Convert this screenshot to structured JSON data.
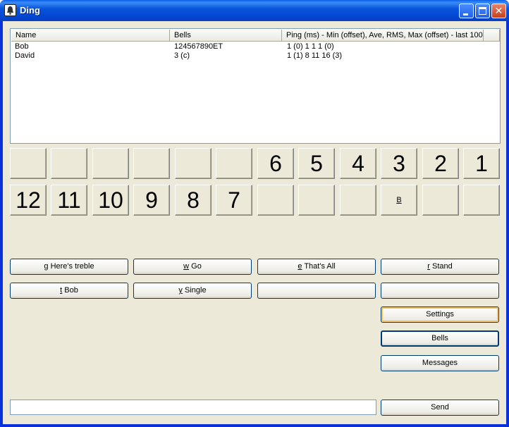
{
  "window": {
    "title": "Ding"
  },
  "players_list": {
    "columns": [
      "Name",
      "Bells",
      "Ping (ms) - Min (offset), Ave, RMS, Max (offset) - last 100"
    ],
    "rows": [
      {
        "name": "Bob",
        "bells": "124567890ET",
        "ping": "1 (0) 1 1 1 (0)"
      },
      {
        "name": "David",
        "bells": "3 (c)",
        "ping": "1 (1) 8 11 16 (3)"
      }
    ]
  },
  "bells": {
    "row1": [
      "",
      "",
      "",
      "",
      "",
      "",
      "6",
      "5",
      "4",
      "3",
      "2",
      "1"
    ],
    "row2": [
      "12",
      "11",
      "10",
      "9",
      "8",
      "7",
      "",
      "",
      "",
      "B",
      "",
      ""
    ]
  },
  "commands": {
    "heres_treble": {
      "key": "g",
      "label": " Here's treble"
    },
    "go": {
      "key": "w",
      "label": " Go"
    },
    "thats_all": {
      "key": "e",
      "label": " That's All"
    },
    "stand": {
      "key": "r",
      "label": " Stand"
    },
    "bob": {
      "key": "t",
      "label": " Bob"
    },
    "single": {
      "key": "y",
      "label": " Single"
    }
  },
  "buttons": {
    "settings": "Settings",
    "bells": "Bells",
    "messages": "Messages",
    "send": "Send"
  },
  "message_input": {
    "value": ""
  }
}
